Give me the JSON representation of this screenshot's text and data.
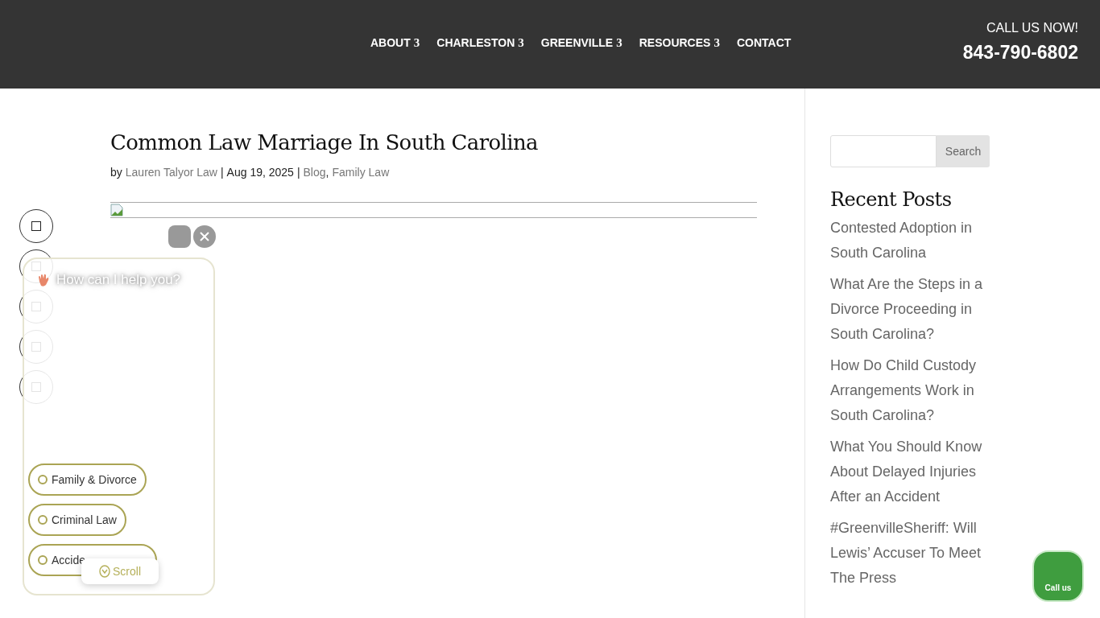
{
  "nav": [
    {
      "label": "ABOUT",
      "caret": "3"
    },
    {
      "label": "CHARLESTON",
      "caret": "3"
    },
    {
      "label": "GREENVILLE",
      "caret": "3"
    },
    {
      "label": "RESOURCES",
      "caret": "3"
    },
    {
      "label": "CONTACT"
    }
  ],
  "call": {
    "label": "CALL US NOW!",
    "phone": "843-790-6802"
  },
  "post": {
    "title": "Common Law Marriage In South Carolina",
    "by": "by",
    "author": "Lauren Talyor Law",
    "date": "Aug 19, 2025",
    "separator": "|",
    "category_separator": ",",
    "categories": [
      "Blog",
      "Family Law"
    ]
  },
  "sidebar": {
    "search_button": "Search",
    "recent_title": "Recent Posts",
    "recent_posts": [
      "Contested Adoption in South Carolina",
      "What Are the Steps in a Divorce Proceeding in South Carolina?",
      "How Do Child Custody Arrangements Work in South Carolina?",
      "What You Should Know About Delayed Injuries After an Accident",
      "#GreenvilleSheriff: Will Lewis’ Accuser To Meet The Press"
    ]
  },
  "chat": {
    "greeting": "How can I help you?",
    "chips": [
      "Family & Divorce",
      "Criminal Law",
      "Accide"
    ],
    "scroll": "Scroll"
  },
  "call_button": "Call us"
}
